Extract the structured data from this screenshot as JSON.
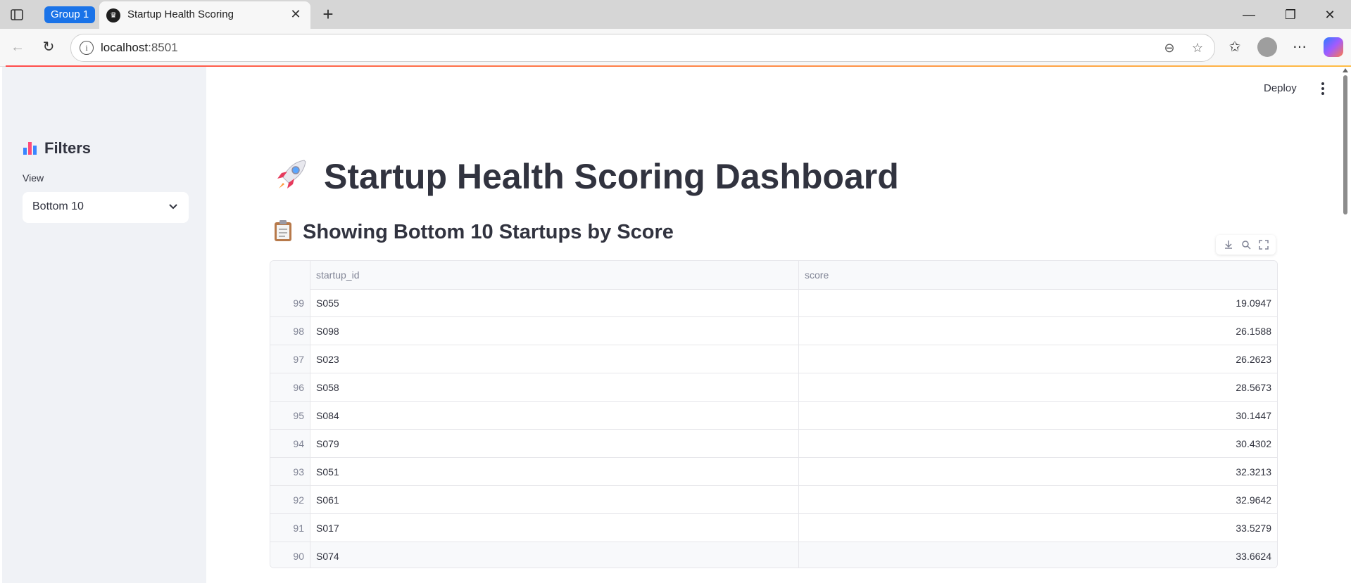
{
  "browser": {
    "group_label": "Group 1",
    "tab_title": "Startup Health Scoring",
    "url_host": "localhost",
    "url_port": ":8501"
  },
  "sidebar": {
    "title": "Filters",
    "view_label": "View",
    "view_selected": "Bottom 10"
  },
  "header": {
    "deploy_label": "Deploy"
  },
  "main": {
    "title": "Startup Health Scoring Dashboard",
    "subtitle": "Showing Bottom 10 Startups by Score"
  },
  "table": {
    "columns": [
      "",
      "startup_id",
      "score"
    ],
    "rows": [
      {
        "index": "99",
        "startup_id": "S055",
        "score": "19.0947"
      },
      {
        "index": "98",
        "startup_id": "S098",
        "score": "26.1588"
      },
      {
        "index": "97",
        "startup_id": "S023",
        "score": "26.2623"
      },
      {
        "index": "96",
        "startup_id": "S058",
        "score": "28.5673"
      },
      {
        "index": "95",
        "startup_id": "S084",
        "score": "30.1447"
      },
      {
        "index": "94",
        "startup_id": "S079",
        "score": "30.4302"
      },
      {
        "index": "93",
        "startup_id": "S051",
        "score": "32.3213"
      },
      {
        "index": "92",
        "startup_id": "S061",
        "score": "32.9642"
      },
      {
        "index": "91",
        "startup_id": "S017",
        "score": "33.5279"
      },
      {
        "index": "90",
        "startup_id": "S074",
        "score": "33.6624"
      }
    ]
  },
  "colors": {
    "accent": "#ff4b4b",
    "sidebar_bg": "#f0f2f6",
    "text": "#31333f",
    "group_chip": "#1a73e8"
  }
}
